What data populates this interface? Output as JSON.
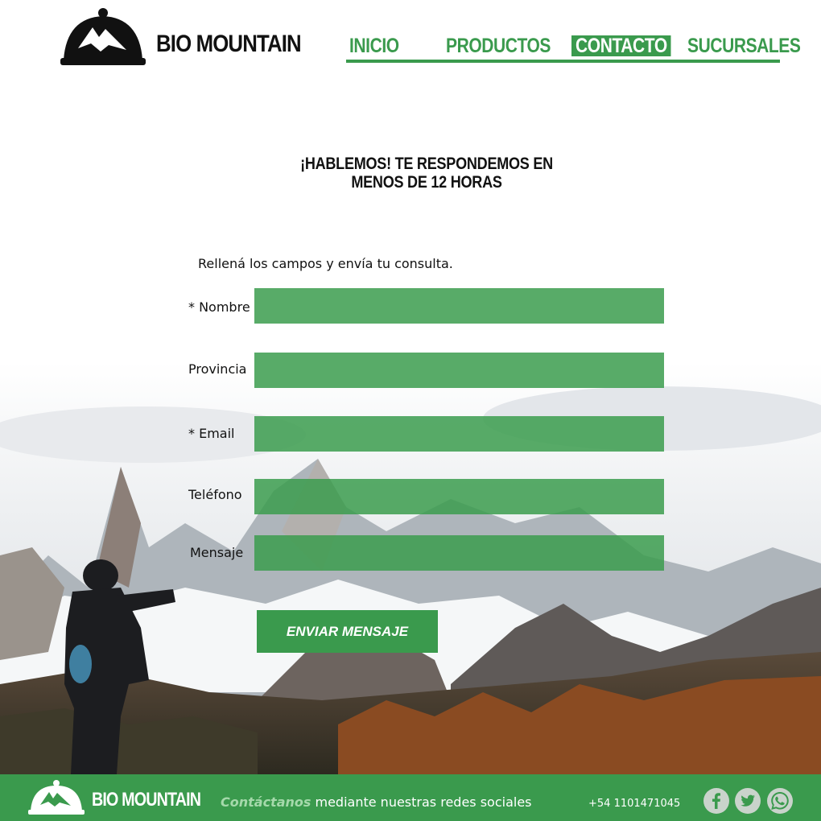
{
  "brand": {
    "name": "BIO MOUNTAIN"
  },
  "nav": {
    "items": [
      {
        "label": "INICIO"
      },
      {
        "label": "PRODUCTOS"
      },
      {
        "label": "CONTACTO",
        "active": true
      },
      {
        "label": "SUCURSALES"
      }
    ]
  },
  "main": {
    "headline_line1": "¡HABLEMOS! TE RESPONDEMOS EN",
    "headline_line2": "MENOS DE 12 HORAS",
    "intro": "Rellená los campos y envía tu consulta."
  },
  "form": {
    "fields": [
      {
        "label": "* Nombre",
        "value": ""
      },
      {
        "label": "Provincia",
        "value": ""
      },
      {
        "label": "* Email",
        "value": ""
      },
      {
        "label": "Teléfono",
        "value": ""
      },
      {
        "label": "Mensaje",
        "value": ""
      }
    ],
    "submit_label": "ENVIAR MENSAJE"
  },
  "footer": {
    "brand": "BIO MOUNTAIN",
    "cta_lead": "Contáctanos",
    "cta_rest": "mediante nuestras redes sociales",
    "phone": "+54 1101471045",
    "social": [
      "facebook-icon",
      "twitter-icon",
      "whatsapp-icon"
    ]
  },
  "colors": {
    "accent": "#3a9a4d",
    "field": "#3b9c4e",
    "text": "#111111"
  }
}
